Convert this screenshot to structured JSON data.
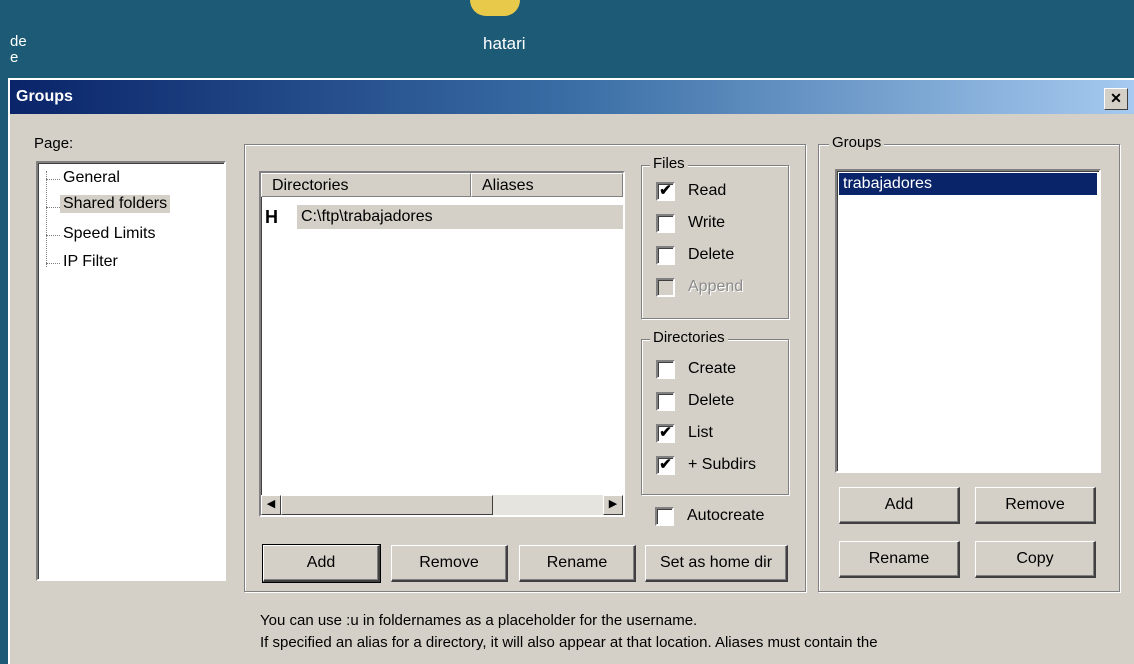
{
  "desktop": {
    "left_label_line1": "de",
    "left_label_line2": "e",
    "center_label": "hatari"
  },
  "dialog": {
    "title": "Groups",
    "close_glyph": "✕"
  },
  "page_tree": {
    "label": "Page:",
    "items": [
      {
        "label": "General"
      },
      {
        "label": "Shared folders",
        "selected": true
      },
      {
        "label": "Speed Limits"
      },
      {
        "label": "IP Filter"
      }
    ]
  },
  "shared_folders": {
    "columns": [
      "Directories",
      "Aliases"
    ],
    "rows": [
      {
        "marker": "H",
        "directory": "C:\\ftp\\trabajadores",
        "alias": ""
      }
    ],
    "buttons": {
      "add": "Add",
      "remove": "Remove",
      "rename": "Rename",
      "set_home": "Set as home dir"
    }
  },
  "files_permissions": {
    "title": "Files",
    "items": [
      {
        "label": "Read",
        "checked": true,
        "disabled": false
      },
      {
        "label": "Write",
        "checked": false,
        "disabled": false
      },
      {
        "label": "Delete",
        "checked": false,
        "disabled": false
      },
      {
        "label": "Append",
        "checked": false,
        "disabled": true
      }
    ]
  },
  "dir_permissions": {
    "title": "Directories",
    "items": [
      {
        "label": "Create",
        "checked": false
      },
      {
        "label": "Delete",
        "checked": false
      },
      {
        "label": "List",
        "checked": true
      },
      {
        "label": "+ Subdirs",
        "checked": true
      }
    ]
  },
  "autocreate": {
    "label": "Autocreate",
    "checked": false
  },
  "groups_panel": {
    "title": "Groups",
    "items": [
      {
        "label": "trabajadores",
        "selected": true
      }
    ],
    "buttons": {
      "add": "Add",
      "remove": "Remove",
      "rename": "Rename",
      "copy": "Copy"
    }
  },
  "notes": {
    "line1": "You can use :u in foldernames as a placeholder for the username.",
    "line2": "If specified an alias for a directory, it will also appear at that location. Aliases must contain the"
  },
  "check_glyph": "✔",
  "colors": {
    "desktop": "#1d5a75",
    "dialog_bg": "#d4d0c8",
    "selection": "#0a246a",
    "titlebar_start": "#0a246a",
    "titlebar_end": "#a6caf0"
  }
}
